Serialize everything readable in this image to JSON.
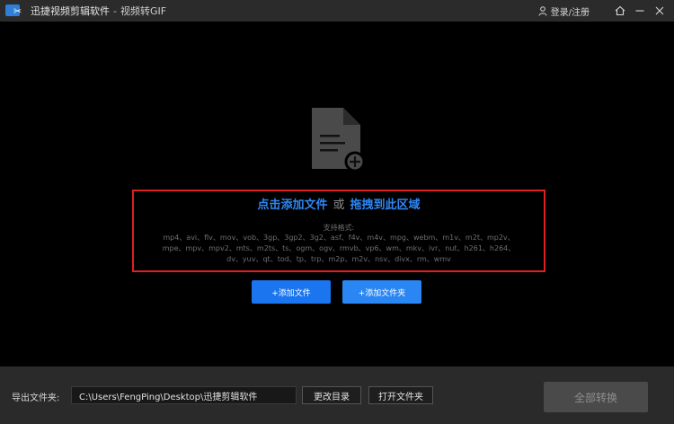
{
  "window": {
    "app_name": "迅捷视频剪辑软件",
    "separator": "-",
    "mode_title": "视频转GIF",
    "login_label": "登录/注册"
  },
  "icons": {
    "app_logo": "scissors-logo-icon",
    "user": "user-icon",
    "home": "home-icon",
    "minimize": "minimize-icon",
    "close": "close-icon",
    "file_add": "file-add-icon"
  },
  "drop_zone": {
    "click_add": "点击添加文件",
    "or": "或",
    "drag_here": "拖拽到此区域",
    "formats_label": "支持格式:",
    "formats_lines": [
      "mp4、avi、flv、mov、vob、3gp、3gp2、3g2、asf、f4v、m4v、mpg、webm、m1v、m2t、mp2v、",
      "mpe、mpv、mpv2、mts、m2ts、ts、ogm、ogv、rmvb、vp6、wm、mkv、ivr、nut、h261、h264、",
      "dv、yuv、qt、tod、tp、trp、m2p、m2v、nsv、divx、rm、wmv"
    ]
  },
  "actions": {
    "add_file": "+添加文件",
    "add_folder": "+添加文件夹"
  },
  "footer": {
    "output_label": "导出文件夹:",
    "output_path": "C:\\Users\\FengPing\\Desktop\\迅捷剪辑软件",
    "change_dir": "更改目录",
    "open_folder": "打开文件夹",
    "convert_all": "全部转换"
  },
  "colors": {
    "accent": "#2f87f5",
    "button_blue": "#1a75ee",
    "highlight_border": "#e02020",
    "titlebar": "#2b2b2b",
    "bottombar": "#2a2a2a",
    "disabled_button": "#4a4a4a"
  }
}
